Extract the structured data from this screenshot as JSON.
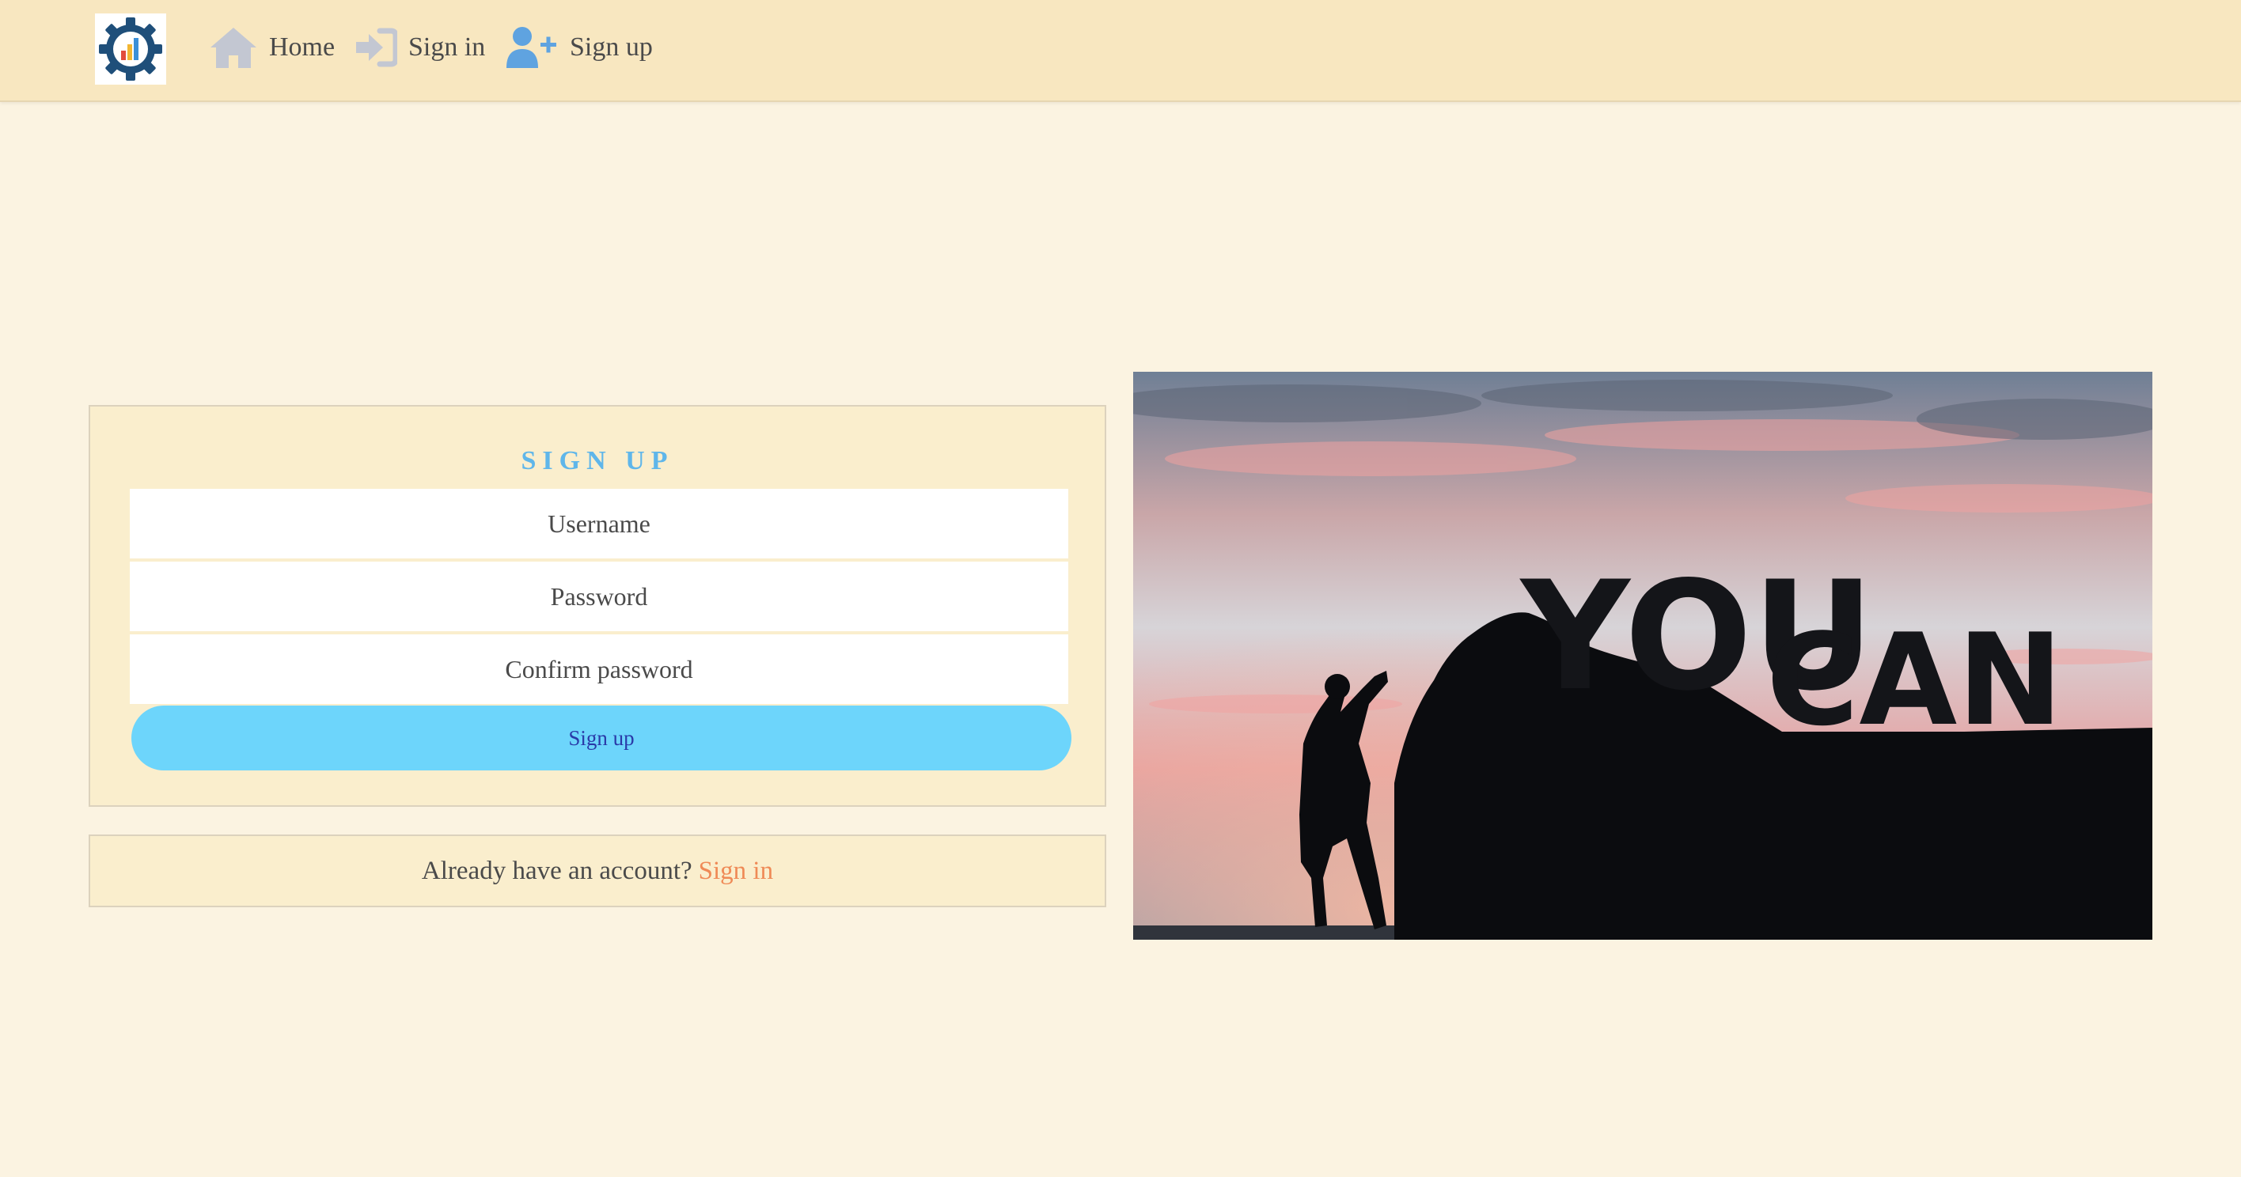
{
  "nav": {
    "logo_icon": "gear-chart-logo-icon",
    "home_label": "Home",
    "home_icon": "house-icon",
    "signin_label": "Sign in",
    "signin_icon": "sign-in-arrow-icon",
    "signup_label": "Sign up",
    "signup_icon": "user-plus-icon"
  },
  "form": {
    "title": "SIGN UP",
    "username_placeholder": "Username",
    "password_placeholder": "Password",
    "confirm_placeholder": "Confirm password",
    "submit_label": "Sign up"
  },
  "footer": {
    "prompt": "Already have an account?",
    "signin_link": "Sign in"
  },
  "hero": {
    "text_word1": "YOU",
    "text_word2": "CAN"
  },
  "colors": {
    "navbar_bg": "#f8e7c0",
    "page_bg": "#fbf3e1",
    "card_bg": "#faeecd",
    "title_blue": "#5fb6ea",
    "button_bg": "#6dd5fb",
    "button_text": "#2a3aa8",
    "link_orange": "#ef8a56"
  }
}
